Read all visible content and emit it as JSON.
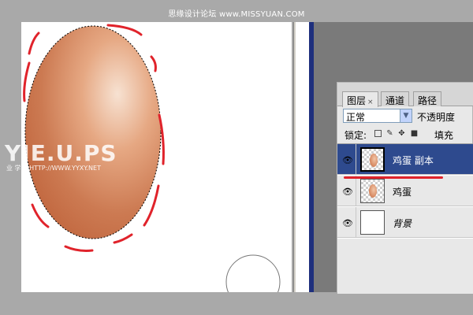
{
  "banner": {
    "text": "思缘设计论坛 www.MISSYUAN.COM"
  },
  "watermark": {
    "title": "YIE.U.PS",
    "subtitle": "业    学院  HTTP://WWW.YYXY.NET"
  },
  "layers_panel": {
    "tabs": [
      {
        "label": "图层",
        "close": "×",
        "active": true
      },
      {
        "label": "通道",
        "active": false
      },
      {
        "label": "路径",
        "active": false
      }
    ],
    "blend_mode": "正常",
    "opacity_label": "不透明度",
    "lock_label": "锁定:",
    "fill_label": "填充",
    "layers": [
      {
        "name": "鸡蛋 副本",
        "selected": true,
        "visible": true
      },
      {
        "name": "鸡蛋",
        "selected": false,
        "visible": true
      },
      {
        "name": "背景",
        "selected": false,
        "visible": true
      }
    ]
  },
  "colors": {
    "egg_light": "#f5dcc8",
    "egg_dark": "#c46a42",
    "annotation_red": "#e0232b",
    "selected_layer": "#2e4a8e"
  },
  "icons": [
    "eye-icon",
    "lock-transparent-icon",
    "brush-icon",
    "move-icon",
    "lock-icon",
    "dropdown-arrow-icon",
    "tab-close-icon"
  ]
}
